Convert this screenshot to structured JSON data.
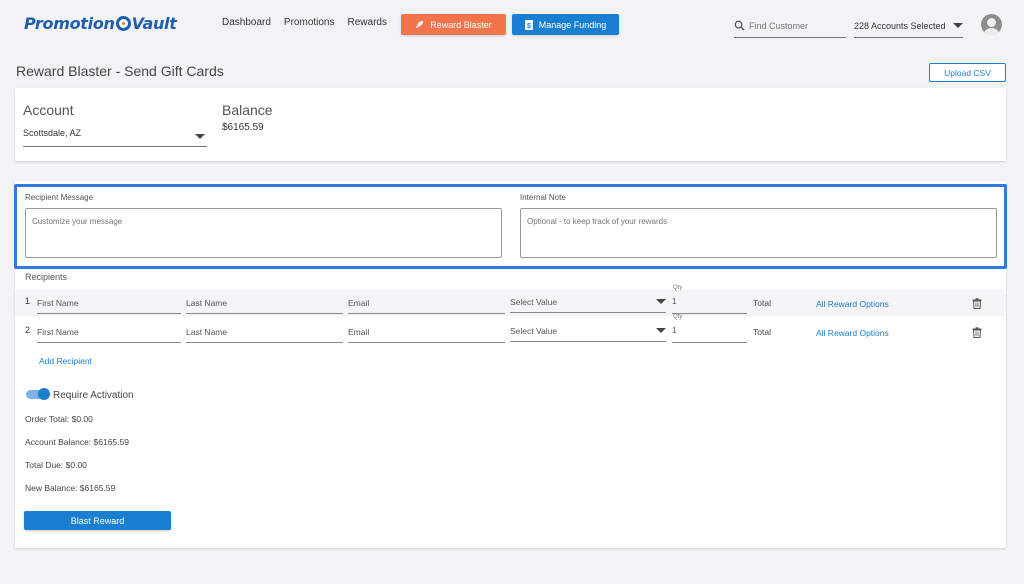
{
  "header": {
    "logo_text_1": "Promotion",
    "logo_text_2": "Vault",
    "nav": [
      "Dashboard",
      "Promotions",
      "Rewards"
    ],
    "reward_blaster_label": "Reward Blaster",
    "manage_funding_label": "Manage Funding",
    "search_placeholder": "Find Customer",
    "accounts_selected": "228 Accounts Selected"
  },
  "page": {
    "title": "Reward Blaster - Send Gift Cards",
    "upload_label": "Upload CSV"
  },
  "account": {
    "label": "Account",
    "value": "Scottsdale, AZ",
    "balance_label": "Balance",
    "balance_value": "$6165.59"
  },
  "message": {
    "recipient_label": "Recipient Message",
    "recipient_placeholder": "Customize your message",
    "note_label": "Internal Note",
    "note_placeholder": "Optional - to keep track of your rewards"
  },
  "recipients": {
    "label": "Recipients",
    "rows": [
      {
        "num": "1",
        "first": "First Name",
        "last": "Last Name",
        "email": "Email",
        "select": "Select Value",
        "qty_label": "Qty",
        "qty": "1",
        "total": "Total",
        "link": "All Reward Options"
      },
      {
        "num": "2",
        "first": "First Name",
        "last": "Last Name",
        "email": "Email",
        "select": "Select Value",
        "qty_label": "Qty",
        "qty": "1",
        "total": "Total",
        "link": "All Reward Options"
      }
    ],
    "add_label": "Add Recipient"
  },
  "activation": {
    "label": "Require Activation",
    "enabled": true
  },
  "summary": {
    "order_total": "Order Total: $0.00",
    "account_balance": "Account Balance: $6165.59",
    "total_due": "Total Due: $0.00",
    "new_balance": "New Balance: $6165.59"
  },
  "blast_label": "Blast Reward",
  "colors": {
    "brand_blue": "#1a7ed1",
    "blaster_orange": "#f2744a",
    "highlight_blue": "#2f7be0"
  }
}
